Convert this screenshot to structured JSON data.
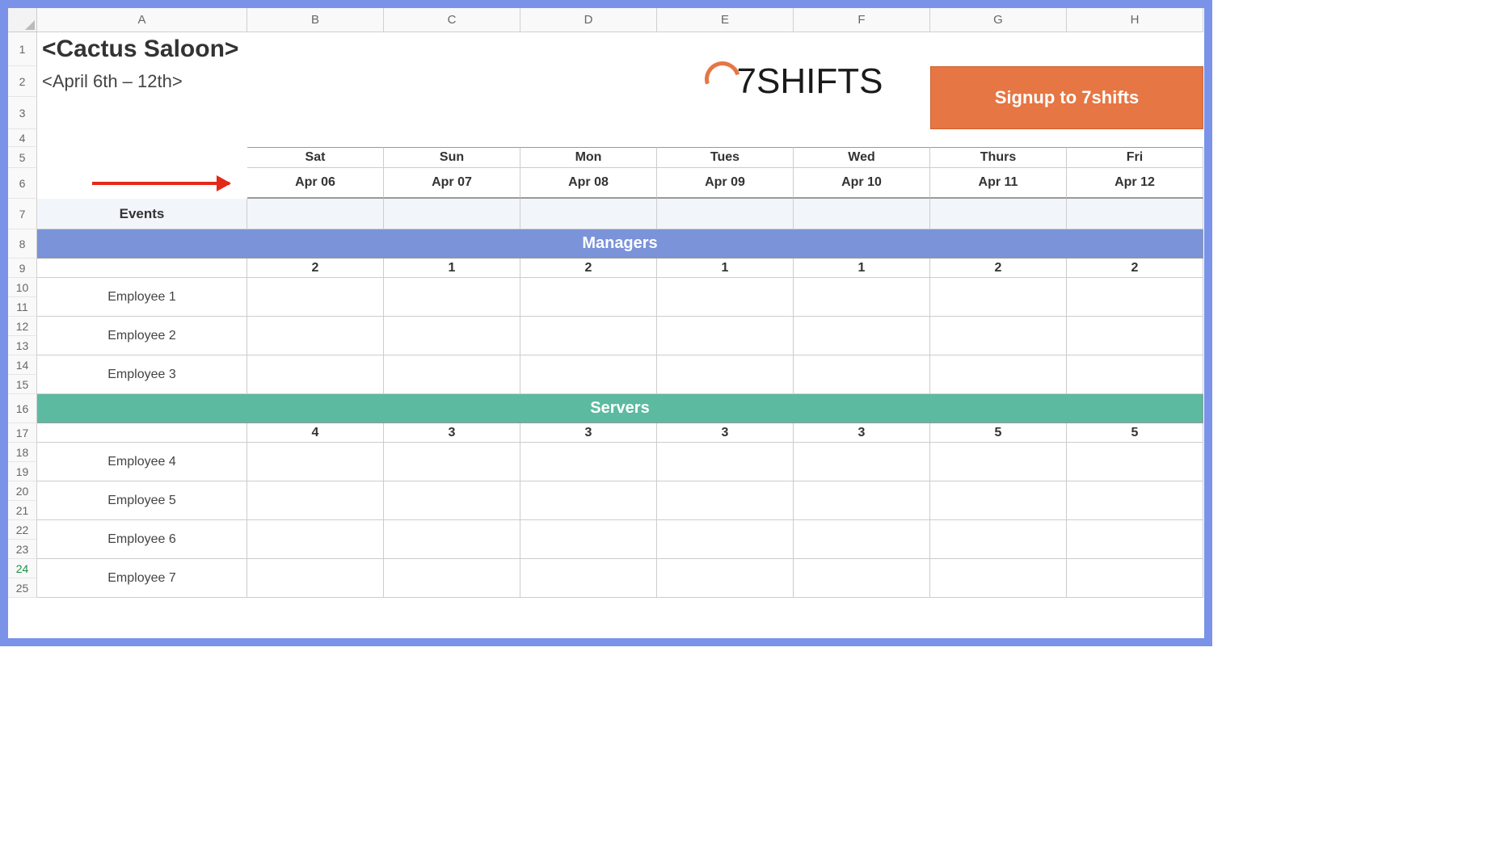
{
  "columns": [
    "A",
    "B",
    "C",
    "D",
    "E",
    "F",
    "G",
    "H"
  ],
  "row_numbers": [
    1,
    2,
    3,
    4,
    5,
    6,
    7,
    8,
    9,
    10,
    11,
    12,
    13,
    14,
    15,
    16,
    17,
    18,
    19,
    20,
    21,
    22,
    23,
    24,
    25
  ],
  "title": "<Cactus Saloon>",
  "subtitle": "<April 6th – 12th>",
  "logo_text": "7SHIFTS",
  "signup_label": "Signup to 7shifts",
  "days": [
    "Sat",
    "Sun",
    "Mon",
    "Tues",
    "Wed",
    "Thurs",
    "Fri"
  ],
  "dates": [
    "Apr 06",
    "Apr 07",
    "Apr 08",
    "Apr 09",
    "Apr 10",
    "Apr 11",
    "Apr 12"
  ],
  "events_label": "Events",
  "sections": {
    "managers": {
      "title": "Managers",
      "counts": [
        "2",
        "1",
        "2",
        "1",
        "1",
        "2",
        "2"
      ],
      "employees": [
        "Employee 1",
        "Employee 2",
        "Employee 3"
      ]
    },
    "servers": {
      "title": "Servers",
      "counts": [
        "4",
        "3",
        "3",
        "3",
        "3",
        "5",
        "5"
      ],
      "employees": [
        "Employee 4",
        "Employee 5",
        "Employee 6",
        "Employee 7"
      ]
    }
  }
}
